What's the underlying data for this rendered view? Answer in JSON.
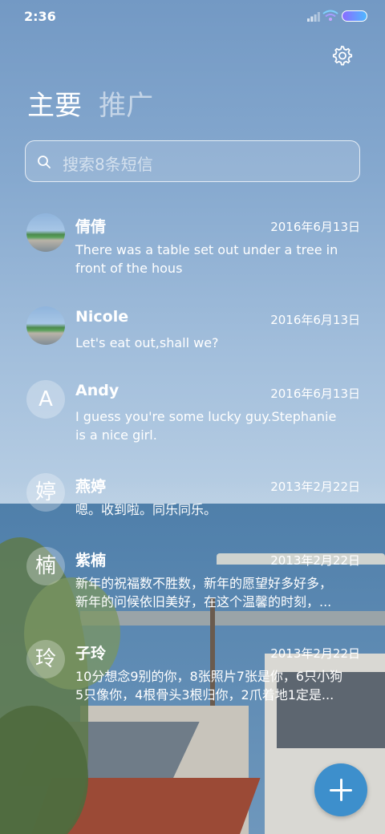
{
  "status_bar": {
    "time": "2:36",
    "icons": [
      "signal-icon",
      "wifi-icon",
      "battery-icon"
    ]
  },
  "header": {
    "settings_icon": "gear-icon"
  },
  "tabs": [
    {
      "label": "主要",
      "active": true
    },
    {
      "label": "推广",
      "active": false
    }
  ],
  "search": {
    "placeholder": "搜索8条短信",
    "icon": "search-icon"
  },
  "conversations": [
    {
      "avatar_type": "photo",
      "avatar_text": "",
      "name": "倩倩",
      "date": "2016年6月13日",
      "preview": "There was a table set out under a tree in\nfront of the hous"
    },
    {
      "avatar_type": "photo",
      "avatar_text": "",
      "name": "Nicole",
      "date": "2016年6月13日",
      "preview": "Let's eat out,shall we?"
    },
    {
      "avatar_type": "letter",
      "avatar_text": "A",
      "name": "Andy",
      "date": "2016年6月13日",
      "preview": "I guess you're some lucky guy.Stephanie\nis a nice girl."
    },
    {
      "avatar_type": "letter",
      "avatar_text": "婷",
      "name": "燕婷",
      "date": "2013年2月22日",
      "preview": "嗯。收到啦。同乐同乐。"
    },
    {
      "avatar_type": "letter",
      "avatar_text": "楠",
      "name": "紫楠",
      "date": "2013年2月22日",
      "preview": "新年的祝福数不胜数，新年的愿望好多好多，\n新年的问候依旧美好，在这个温馨的时刻，..."
    },
    {
      "avatar_type": "letter",
      "avatar_text": "玲",
      "name": "子玲",
      "date": "2013年2月22日",
      "preview": "10分想念9别的你，8张照片7张是你，6只小狗\n5只像你，4根骨头3根归你，2爪着地1定是..."
    }
  ],
  "fab": {
    "icon": "plus-icon"
  },
  "colors": {
    "fab": "#3d8fcc",
    "text": "#ffffff"
  }
}
